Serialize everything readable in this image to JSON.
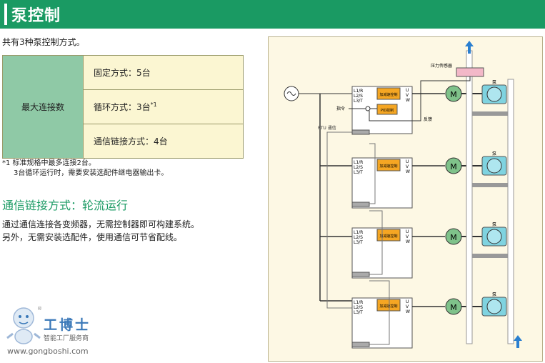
{
  "header": {
    "title": "泵控制"
  },
  "intro": "共有3种泵控制方式。",
  "spec_table": {
    "label": "最大连接数",
    "rows": [
      {
        "text": "固定方式：5台",
        "mark": ""
      },
      {
        "text": "循环方式：3台",
        "mark": "*1"
      },
      {
        "text": "通信链接方式：4台",
        "mark": ""
      }
    ]
  },
  "notes": {
    "note1": "*1  标准规格中最多连接2台。",
    "note2": "3台循环运行时，需要安装选配件继电器输出卡。"
  },
  "section": {
    "title": "通信链接方式：轮流运行",
    "para1": "通过通信连接各变频器，无需控制器即可构建系统。",
    "para2": "另外，无需安装选配件，使用通信可节省配线。"
  },
  "logo": {
    "name": "工博士",
    "subtitle": "智能工厂服务商",
    "url": "www.gongboshi.com",
    "reg_mark": "®"
  },
  "diagram": {
    "pressure_sensor": "压力传感器",
    "command_label": "指令",
    "feedback_label": "反馈",
    "rtu_label": "RTU 通信",
    "inputs": [
      "L1/R",
      "L2/S",
      "L3/T"
    ],
    "outputs": [
      "U",
      "V",
      "W"
    ],
    "block_accel": "加减速控制",
    "block_pid": "PID控制",
    "motor_label": "M",
    "pump_label": "泵",
    "colors": {
      "panel_bg": "#fdf8e4",
      "block_orange": "#f5a623",
      "motor_green": "#7fc28a",
      "pump_cyan": "#7fd3e0",
      "sensor_pink": "#f3b8c8",
      "arrow_blue": "#2a7fd0",
      "header_green": "#1a9a63"
    }
  }
}
